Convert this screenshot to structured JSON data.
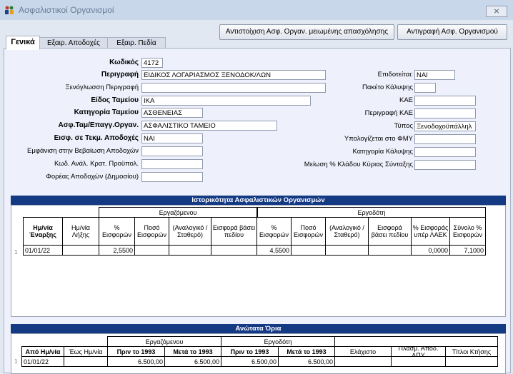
{
  "window": {
    "title": "Ασφαλιστικοί Οργανισμοί",
    "close_label": "⨯"
  },
  "tabs": [
    "Γενικά",
    "Εξαιρ. Αποδοχές",
    "Εξαιρ. Πεδία"
  ],
  "buttons": {
    "match": "Αντιστοίχιση Ασφ. Οργαν. μειωμένης απασχόλησης",
    "copy": "Αντιγραφή Ασφ. Οργανισμού"
  },
  "form_left": {
    "code": {
      "label": "Κωδικός",
      "value": "4172"
    },
    "description": {
      "label": "Περιγραφή",
      "value": "ΕΙΔΙΚΟΣ ΛΟΓΑΡΙΑΣΜΟΣ ΞΕΝΟΔΟΚ/ΛΩΝ"
    },
    "foreign_description": {
      "label": "Ξενόγλωσση Περιγραφή",
      "value": ""
    },
    "fund_type": {
      "label": "Είδος Ταμείου",
      "value": "ΙΚΑ"
    },
    "fund_category": {
      "label": "Κατηγορία Ταμείου",
      "value": "ΑΣΘΕΝΕΙΑΣ"
    },
    "ins_fund": {
      "label": "Ασφ.Ταμ/Επαγγ.Οργαν.",
      "value": "ΑΣΦΑΛΙΣΤΙΚΟ ΤΑΜΕΙΟ"
    },
    "earnings_entry": {
      "label": "Εισφ. σε Τεκμ. Αποδοχές",
      "value": "ΝΑΙ"
    },
    "show_cert": {
      "label": "Εμφάνιση στην Βεβαίωση Αποδοχών",
      "value": ""
    },
    "analysis_code": {
      "label": "Κωδ. Ανάλ. Κρατ. Προϋπολ.",
      "value": ""
    },
    "public_body": {
      "label": "Φορέας Αποδοχών (Δημοσίου)",
      "value": ""
    }
  },
  "form_right": {
    "subsidized": {
      "label": "Επιδοτείται",
      "value": "ΝΑΙ"
    },
    "coverage_package": {
      "label": "Πακέτο Κάλυψης",
      "value": ""
    },
    "kae": {
      "label": "ΚΑΕ",
      "value": ""
    },
    "kae_desc": {
      "label": "Περιγραφή ΚΑΕ",
      "value": ""
    },
    "type": {
      "label": "Τύπος",
      "value": "Ξενοδοχοϋπάλληλ"
    },
    "fmy": {
      "label": "Υπολογίζεται στο ΦΜΥ",
      "value": ""
    },
    "coverage_category": {
      "label": "Κατηγορία Κάλυψης",
      "value": ""
    },
    "reduction": {
      "label": "Μείωση % Κλάδου Κύριας Σύνταξης",
      "value": ""
    }
  },
  "history": {
    "title": "Ιστορικότητα Ασφαλιστικών Οργανισμών",
    "group_employee": "Εργαζόμενου",
    "group_employer": "Εργοδότη",
    "columns": [
      "Ημ/νία Έναρξης",
      "Ημ/νία Λήξης",
      "% Εισφορών",
      "Ποσό Εισφορών",
      "(Αναλογικό / Σταθερό)",
      "Εισφορά βάσει πεδίου",
      "% Εισφορών",
      "Ποσό Εισφορών",
      "(Αναλογικό / Σταθερό)",
      "Εισφορά βάσει πεδίου",
      "% Εισφοράς υπέρ ΛΑΕΚ",
      "Σύνολο % Εισφορών"
    ],
    "row_indicator": "1",
    "rows": [
      [
        "01/01/22",
        "",
        "2,5500",
        "",
        "",
        "",
        "4,5500",
        "",
        "",
        "",
        "0,0000",
        "7,1000"
      ]
    ]
  },
  "limits": {
    "title": "Ανώτατα Όρια",
    "group_employee": "Εργαζόμενου",
    "group_employer": "Εργοδότη",
    "columns": [
      "Από Ημ/νία",
      "Έως Ημ/νία",
      "Πριν το 1993",
      "Μετά το 1993",
      "Πριν το 1993",
      "Μετά το 1993",
      "Ελάχιστο",
      "Πλασμ. Αποδ. ΔΠΥ",
      "Τίτλοι Κτήσης"
    ],
    "row_indicator": "1",
    "rows": [
      [
        "01/01/22",
        "",
        "6.500,00",
        "6.500,00",
        "6.500,00",
        "6.500,00",
        "",
        "",
        ""
      ]
    ]
  },
  "colors": {
    "section_bar": "#153a84",
    "panel": "#eef0fb",
    "titlebar": "#c8d7ea"
  }
}
